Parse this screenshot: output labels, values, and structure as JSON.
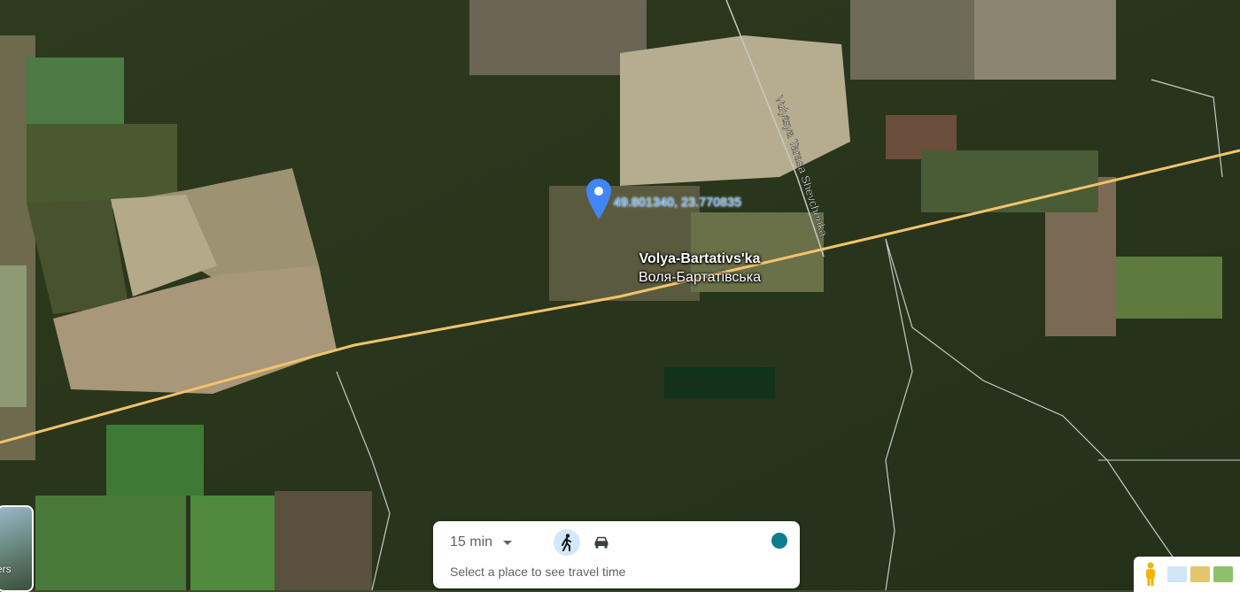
{
  "map": {
    "view": "satellite",
    "pin": {
      "coordinates_label": "49.801340, 23.770835",
      "color": "#4285f4"
    },
    "place": {
      "name_latin": "Volya-Bartativs'ka",
      "name_cyrillic": "Воля-Бартатівська"
    },
    "street_label": "Vulytsya Tarasa Shevchenka",
    "road_color": "#f2c36b"
  },
  "travel_card": {
    "time_value": "15 min",
    "hint": "Select a place to see travel time",
    "modes": [
      {
        "icon": "walk-icon",
        "selected": true
      },
      {
        "icon": "car-icon",
        "selected": false
      }
    ],
    "accent_color": "#0e7d8c"
  },
  "layers": {
    "label": "ers"
  },
  "bottom_tools": {
    "pegman_icon": "pegman-icon",
    "thumbnails": [
      "#cfe6f5",
      "#e3c56b",
      "#8fbf6a"
    ]
  }
}
